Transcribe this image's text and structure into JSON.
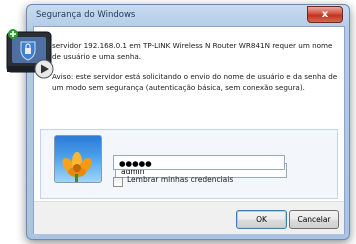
{
  "window": {
    "title": "Segurança do Windows",
    "close_label": "x"
  },
  "message": {
    "line1": "servidor 192.168.0.1 em TP-LINK Wireless N Router WR841N requer um nome de usuário e uma senha.",
    "line2": "Aviso: este servidor está solicitando o envio do nome de usuário e da senha de um modo sem segurança (autenticação básica, sem conexão segura)."
  },
  "credentials": {
    "username_value": "admin",
    "password_value": "●●●●●",
    "remember_label": "Lembrar minhas credenciais",
    "remember_checked": false
  },
  "buttons": {
    "ok": "OK",
    "cancel": "Cancelar"
  },
  "icons": {
    "tile": "user-flower-icon",
    "overlay": "video-camera-icon"
  },
  "colors": {
    "titlebar": "#b3cbe6",
    "close": "#c2331f",
    "tile_sky": "#4ca0ea"
  }
}
